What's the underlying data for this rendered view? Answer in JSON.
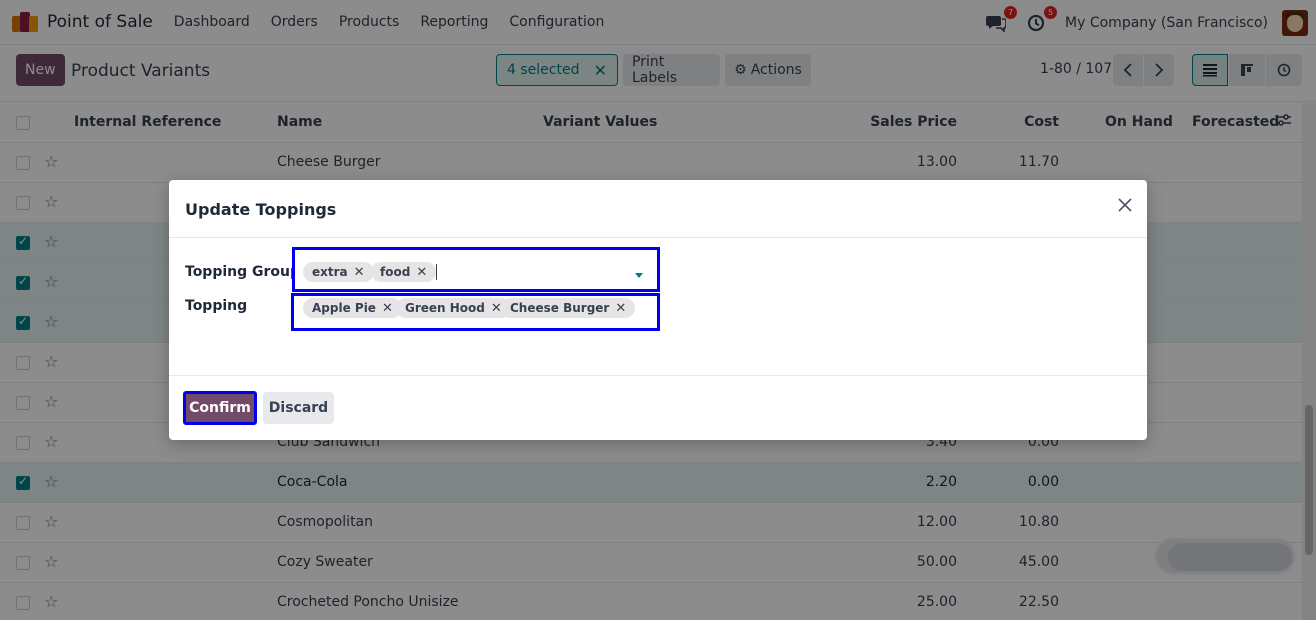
{
  "nav": {
    "app_name": "Point of Sale",
    "menu": [
      "Dashboard",
      "Orders",
      "Products",
      "Reporting",
      "Configuration"
    ],
    "messages_icon": "chat-bubbles-icon",
    "messages_count": "7",
    "activity_icon": "clock-icon",
    "activity_count": "5",
    "company": "My Company (San Francisco)"
  },
  "control": {
    "new_label": "New",
    "title": "Product Variants",
    "selected_label": "4 selected",
    "print_labels": "Print Labels",
    "actions_label": "Actions",
    "pager": "1-80 / 107"
  },
  "table": {
    "columns": {
      "internal_ref": "Internal Reference",
      "name": "Name",
      "variant_values": "Variant Values",
      "sales_price": "Sales Price",
      "cost": "Cost",
      "on_hand": "On Hand",
      "forecasted": "Forecasted"
    },
    "rows": [
      {
        "name": "Cheese Burger",
        "price": "13.00",
        "cost": "11.70",
        "selected": false
      },
      {
        "name": "",
        "price": "",
        "cost": "",
        "selected": false
      },
      {
        "name": "",
        "price": "",
        "cost": "",
        "selected": true
      },
      {
        "name": "",
        "price": "",
        "cost": "",
        "selected": true
      },
      {
        "name": "",
        "price": "",
        "cost": "",
        "selected": true
      },
      {
        "name": "",
        "price": "",
        "cost": "",
        "selected": false
      },
      {
        "name": "",
        "price": "",
        "cost": "",
        "selected": false
      },
      {
        "name": "Club Sandwich",
        "price": "3.40",
        "cost": "0.00",
        "selected": false
      },
      {
        "name": "Coca-Cola",
        "price": "2.20",
        "cost": "0.00",
        "selected": true
      },
      {
        "name": "Cosmopolitan",
        "price": "12.00",
        "cost": "10.80",
        "selected": false
      },
      {
        "name": "Cozy Sweater",
        "price": "50.00",
        "cost": "45.00",
        "selected": false
      },
      {
        "name": "Crocheted Poncho Unisize",
        "price": "25.00",
        "cost": "22.50",
        "selected": false
      }
    ]
  },
  "modal": {
    "title": "Update Toppings",
    "groups_label": "Topping Groups",
    "groups_tags": [
      "extra",
      "food"
    ],
    "topping_label": "Topping",
    "topping_tags": [
      "Apple Pie",
      "Green Hood",
      "Cheese Burger"
    ],
    "confirm_label": "Confirm",
    "discard_label": "Discard"
  },
  "colors": {
    "brand": "#714b67",
    "accent": "#017e84",
    "highlight_border": "#0000ee"
  }
}
